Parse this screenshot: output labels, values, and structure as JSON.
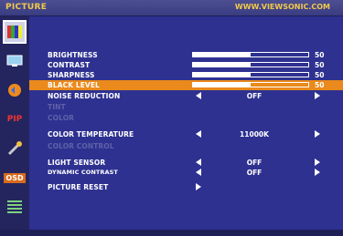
{
  "header": {
    "title": "PICTURE",
    "site": "WWW.VIEWSONIC.COM"
  },
  "sidebar": {
    "items": [
      {
        "icon": "picture-icon",
        "label": "",
        "active": true
      },
      {
        "icon": "monitor-icon",
        "label": ""
      },
      {
        "icon": "audio-icon",
        "label": ""
      },
      {
        "icon": "pip-icon",
        "label": "PIP"
      },
      {
        "icon": "tools-icon",
        "label": ""
      },
      {
        "icon": "osd-icon",
        "label": "OSD"
      },
      {
        "icon": "menu-list-icon",
        "label": ""
      }
    ]
  },
  "menu": {
    "brightness": {
      "label": "BRIGHTNESS",
      "value": "50",
      "level": 50
    },
    "contrast": {
      "label": "CONTRAST",
      "value": "50",
      "level": 50
    },
    "sharpness": {
      "label": "SHARPNESS",
      "value": "50",
      "level": 50
    },
    "black_level": {
      "label": "BLACK LEVEL",
      "value": "50",
      "level": 50
    },
    "noise_reduction": {
      "label": "NOISE REDUCTION",
      "value": "OFF"
    },
    "tint": {
      "label": "TINT"
    },
    "color": {
      "label": "COLOR"
    },
    "color_temperature": {
      "label": "COLOR TEMPERATURE",
      "value": "11000K"
    },
    "color_control": {
      "label": "COLOR CONTROL"
    },
    "light_sensor": {
      "label": "LIGHT SENSOR",
      "value": "OFF"
    },
    "dynamic_contrast": {
      "label": "DYNAMIC CONTRAST",
      "value": "OFF"
    },
    "picture_reset": {
      "label": "PICTURE RESET"
    }
  },
  "colors": {
    "background": "#2e3190",
    "highlight": "#ea8a1c",
    "header_text": "#f2c94a",
    "disabled_text": "#5f61a8"
  }
}
